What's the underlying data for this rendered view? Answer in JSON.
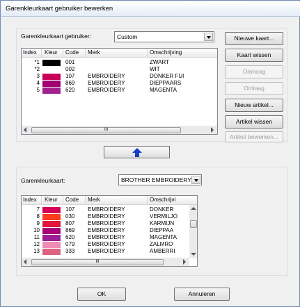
{
  "window": {
    "title": "Garenkleurkaart gebruiker bewerken"
  },
  "top": {
    "label": "Garenkleurkaart gebruiker:",
    "combo_value": "Custom",
    "columns": [
      "Index",
      "Kleur",
      "Code",
      "Merk",
      "Omschrijving"
    ],
    "rows": [
      {
        "index": "*1",
        "color": "#000000",
        "code": "001",
        "brand": "",
        "desc": "ZWART"
      },
      {
        "index": "*2",
        "color": "#ffffff",
        "code": "002",
        "brand": "",
        "desc": "WIT"
      },
      {
        "index": "3",
        "color": "#c8005a",
        "code": "107",
        "brand": "EMBROIDERY",
        "desc": "DONKER FUI"
      },
      {
        "index": "4",
        "color": "#a0006e",
        "code": "869",
        "brand": "EMBROIDERY",
        "desc": "DIEPPAARS"
      },
      {
        "index": "5",
        "color": "#a0208c",
        "code": "620",
        "brand": "EMBROIDERY",
        "desc": "MAGENTA"
      }
    ],
    "scroll_thumb_label": "III"
  },
  "buttons": {
    "new_chart": "Nieuwe kaart...",
    "clear_chart": "Kaart wissen",
    "up": "Omhoog",
    "down": "Omlaag",
    "new_item": "Nieuw artikel...",
    "delete_item": "Artikel wissen",
    "edit_item": "Artikel bewerken...",
    "ok": "OK",
    "cancel": "Annuleren"
  },
  "bottom": {
    "label": "Garenkleurkaart:",
    "combo_value": "BROTHER EMBROIDERY",
    "columns": [
      "Index",
      "Kleur",
      "Code",
      "Merk",
      "Omschrijvi"
    ],
    "rows": [
      {
        "index": "7",
        "color": "#d40055",
        "code": "107",
        "brand": "EMBROIDERY",
        "desc": "DONKER"
      },
      {
        "index": "8",
        "color": "#ff3c1e",
        "code": "030",
        "brand": "EMBROIDERY",
        "desc": "VERMILJO"
      },
      {
        "index": "9",
        "color": "#e0143c",
        "code": "807",
        "brand": "EMBROIDERY",
        "desc": "KARMIJN"
      },
      {
        "index": "10",
        "color": "#aa0078",
        "code": "869",
        "brand": "EMBROIDERY",
        "desc": "DIEPPAA"
      },
      {
        "index": "11",
        "color": "#9a1e96",
        "code": "620",
        "brand": "EMBROIDERY",
        "desc": "MAGENTA"
      },
      {
        "index": "12",
        "color": "#f08cb4",
        "code": "079",
        "brand": "EMBROIDERY",
        "desc": "ZALMRO"
      },
      {
        "index": "13",
        "color": "#dc6482",
        "code": "333",
        "brand": "EMBROIDERY",
        "desc": "AMBERRI"
      }
    ],
    "scroll_thumb_label": "III"
  }
}
